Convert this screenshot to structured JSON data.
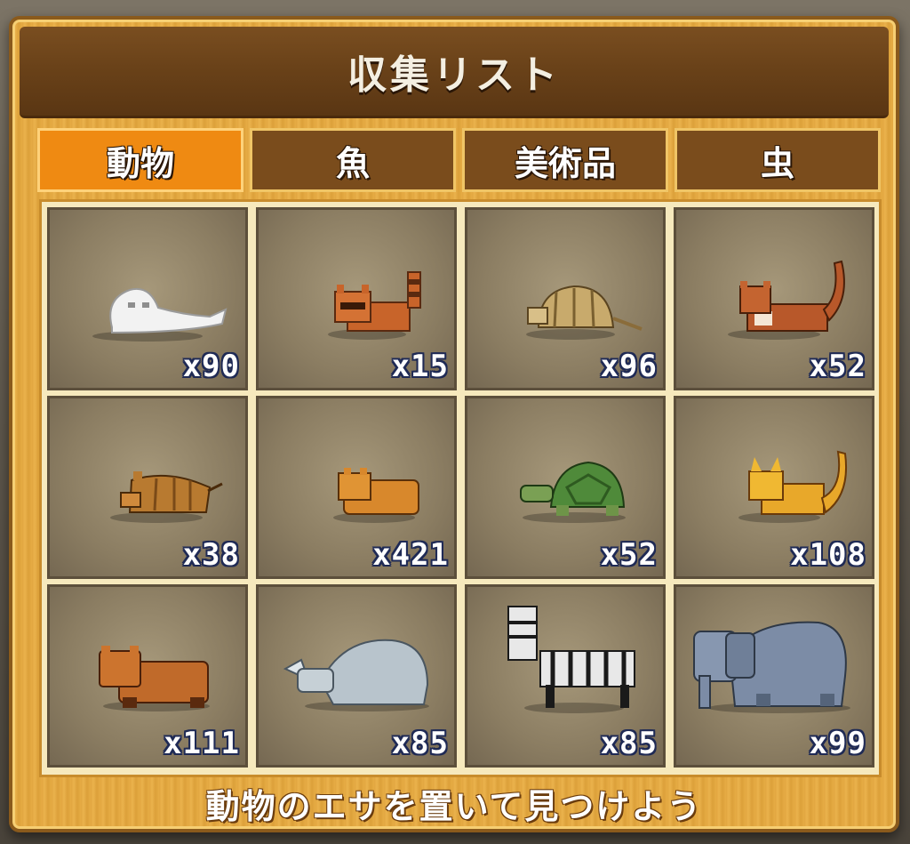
{
  "title": "収集リスト",
  "tabs": [
    {
      "label": "動物",
      "active": true
    },
    {
      "label": "魚",
      "active": false
    },
    {
      "label": "美術品",
      "active": false
    },
    {
      "label": "虫",
      "active": false
    }
  ],
  "items": [
    {
      "icon": "ghost-seal-icon",
      "count": "x90"
    },
    {
      "icon": "raccoon-icon",
      "count": "x15"
    },
    {
      "icon": "armadillo-icon",
      "count": "x96"
    },
    {
      "icon": "weasel-icon",
      "count": "x52"
    },
    {
      "icon": "boar-icon",
      "count": "x38"
    },
    {
      "icon": "capybara-icon",
      "count": "x421"
    },
    {
      "icon": "turtle-icon",
      "count": "x52"
    },
    {
      "icon": "fox-icon",
      "count": "x108"
    },
    {
      "icon": "bear-icon",
      "count": "x111"
    },
    {
      "icon": "rhino-icon",
      "count": "x85"
    },
    {
      "icon": "zebra-icon",
      "count": "x85"
    },
    {
      "icon": "elephant-icon",
      "count": "x99"
    }
  ],
  "footer": "動物のエサを置いて見つけよう",
  "colors": {
    "active_tab": "#ef8a12",
    "inactive_tab": "#7a4c1c",
    "title_bar": "#6a4219"
  }
}
